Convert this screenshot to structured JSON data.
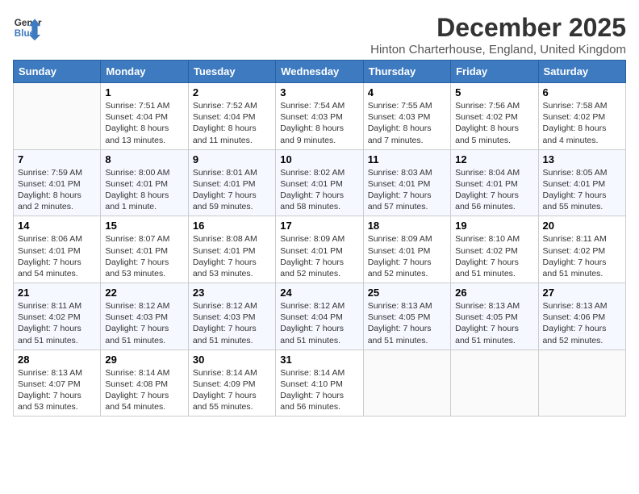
{
  "logo": {
    "line1": "General",
    "line2": "Blue"
  },
  "title": "December 2025",
  "subtitle": "Hinton Charterhouse, England, United Kingdom",
  "headers": [
    "Sunday",
    "Monday",
    "Tuesday",
    "Wednesday",
    "Thursday",
    "Friday",
    "Saturday"
  ],
  "weeks": [
    [
      {
        "empty": true
      },
      {
        "day": "1",
        "sunrise": "7:51 AM",
        "sunset": "4:04 PM",
        "daylight": "8 hours and 13 minutes."
      },
      {
        "day": "2",
        "sunrise": "7:52 AM",
        "sunset": "4:04 PM",
        "daylight": "8 hours and 11 minutes."
      },
      {
        "day": "3",
        "sunrise": "7:54 AM",
        "sunset": "4:03 PM",
        "daylight": "8 hours and 9 minutes."
      },
      {
        "day": "4",
        "sunrise": "7:55 AM",
        "sunset": "4:03 PM",
        "daylight": "8 hours and 7 minutes."
      },
      {
        "day": "5",
        "sunrise": "7:56 AM",
        "sunset": "4:02 PM",
        "daylight": "8 hours and 5 minutes."
      },
      {
        "day": "6",
        "sunrise": "7:58 AM",
        "sunset": "4:02 PM",
        "daylight": "8 hours and 4 minutes."
      }
    ],
    [
      {
        "day": "7",
        "sunrise": "7:59 AM",
        "sunset": "4:01 PM",
        "daylight": "8 hours and 2 minutes."
      },
      {
        "day": "8",
        "sunrise": "8:00 AM",
        "sunset": "4:01 PM",
        "daylight": "8 hours and 1 minute."
      },
      {
        "day": "9",
        "sunrise": "8:01 AM",
        "sunset": "4:01 PM",
        "daylight": "7 hours and 59 minutes."
      },
      {
        "day": "10",
        "sunrise": "8:02 AM",
        "sunset": "4:01 PM",
        "daylight": "7 hours and 58 minutes."
      },
      {
        "day": "11",
        "sunrise": "8:03 AM",
        "sunset": "4:01 PM",
        "daylight": "7 hours and 57 minutes."
      },
      {
        "day": "12",
        "sunrise": "8:04 AM",
        "sunset": "4:01 PM",
        "daylight": "7 hours and 56 minutes."
      },
      {
        "day": "13",
        "sunrise": "8:05 AM",
        "sunset": "4:01 PM",
        "daylight": "7 hours and 55 minutes."
      }
    ],
    [
      {
        "day": "14",
        "sunrise": "8:06 AM",
        "sunset": "4:01 PM",
        "daylight": "7 hours and 54 minutes."
      },
      {
        "day": "15",
        "sunrise": "8:07 AM",
        "sunset": "4:01 PM",
        "daylight": "7 hours and 53 minutes."
      },
      {
        "day": "16",
        "sunrise": "8:08 AM",
        "sunset": "4:01 PM",
        "daylight": "7 hours and 53 minutes."
      },
      {
        "day": "17",
        "sunrise": "8:09 AM",
        "sunset": "4:01 PM",
        "daylight": "7 hours and 52 minutes."
      },
      {
        "day": "18",
        "sunrise": "8:09 AM",
        "sunset": "4:01 PM",
        "daylight": "7 hours and 52 minutes."
      },
      {
        "day": "19",
        "sunrise": "8:10 AM",
        "sunset": "4:02 PM",
        "daylight": "7 hours and 51 minutes."
      },
      {
        "day": "20",
        "sunrise": "8:11 AM",
        "sunset": "4:02 PM",
        "daylight": "7 hours and 51 minutes."
      }
    ],
    [
      {
        "day": "21",
        "sunrise": "8:11 AM",
        "sunset": "4:02 PM",
        "daylight": "7 hours and 51 minutes."
      },
      {
        "day": "22",
        "sunrise": "8:12 AM",
        "sunset": "4:03 PM",
        "daylight": "7 hours and 51 minutes."
      },
      {
        "day": "23",
        "sunrise": "8:12 AM",
        "sunset": "4:03 PM",
        "daylight": "7 hours and 51 minutes."
      },
      {
        "day": "24",
        "sunrise": "8:12 AM",
        "sunset": "4:04 PM",
        "daylight": "7 hours and 51 minutes."
      },
      {
        "day": "25",
        "sunrise": "8:13 AM",
        "sunset": "4:05 PM",
        "daylight": "7 hours and 51 minutes."
      },
      {
        "day": "26",
        "sunrise": "8:13 AM",
        "sunset": "4:05 PM",
        "daylight": "7 hours and 51 minutes."
      },
      {
        "day": "27",
        "sunrise": "8:13 AM",
        "sunset": "4:06 PM",
        "daylight": "7 hours and 52 minutes."
      }
    ],
    [
      {
        "day": "28",
        "sunrise": "8:13 AM",
        "sunset": "4:07 PM",
        "daylight": "7 hours and 53 minutes."
      },
      {
        "day": "29",
        "sunrise": "8:14 AM",
        "sunset": "4:08 PM",
        "daylight": "7 hours and 54 minutes."
      },
      {
        "day": "30",
        "sunrise": "8:14 AM",
        "sunset": "4:09 PM",
        "daylight": "7 hours and 55 minutes."
      },
      {
        "day": "31",
        "sunrise": "8:14 AM",
        "sunset": "4:10 PM",
        "daylight": "7 hours and 56 minutes."
      },
      {
        "empty": true
      },
      {
        "empty": true
      },
      {
        "empty": true
      }
    ]
  ],
  "labels": {
    "sunrise": "Sunrise:",
    "sunset": "Sunset:",
    "daylight": "Daylight hours"
  }
}
